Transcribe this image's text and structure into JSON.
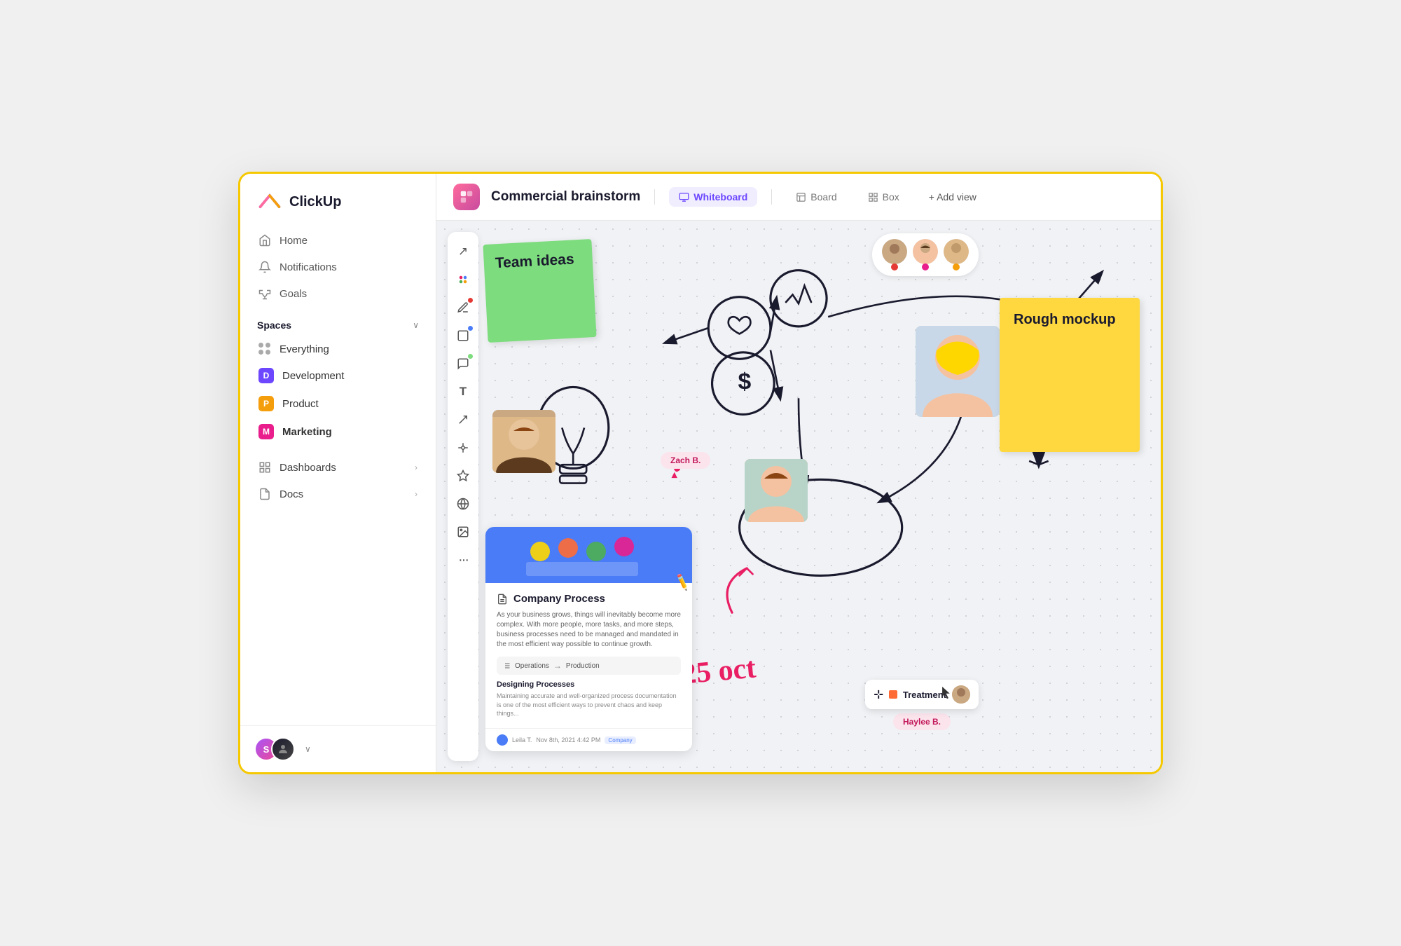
{
  "app": {
    "name": "ClickUp"
  },
  "sidebar": {
    "logo": "ClickUp",
    "nav": [
      {
        "id": "home",
        "label": "Home",
        "icon": "home"
      },
      {
        "id": "notifications",
        "label": "Notifications",
        "icon": "bell"
      },
      {
        "id": "goals",
        "label": "Goals",
        "icon": "trophy"
      }
    ],
    "spaces_label": "Spaces",
    "spaces": [
      {
        "id": "everything",
        "label": "Everything",
        "color": "",
        "initial": ""
      },
      {
        "id": "development",
        "label": "Development",
        "color": "#6c47ff",
        "initial": "D"
      },
      {
        "id": "product",
        "label": "Product",
        "color": "#f59e0b",
        "initial": "P"
      },
      {
        "id": "marketing",
        "label": "Marketing",
        "color": "#e91e8c",
        "initial": "M",
        "bold": true
      }
    ],
    "dashboards_label": "Dashboards",
    "docs_label": "Docs",
    "user_initial": "S"
  },
  "topbar": {
    "title": "Commercial brainstorm",
    "views": [
      {
        "id": "whiteboard",
        "label": "Whiteboard",
        "active": true
      },
      {
        "id": "board",
        "label": "Board",
        "active": false
      },
      {
        "id": "box",
        "label": "Box",
        "active": false
      }
    ],
    "add_view": "+ Add view"
  },
  "canvas": {
    "sticky_green_text": "Team ideas",
    "sticky_yellow_text": "Rough mockup",
    "doc_title": "Company Process",
    "doc_description": "As your business grows, things will inevitably become more complex. With more people, more tasks, and more steps, business processes need to be managed and mandated in the most efficient way possible to continue growth.",
    "doc_process_from": "Operations",
    "doc_process_to": "Production",
    "doc_section_title": "Designing Processes",
    "doc_section_text": "Maintaining accurate and well-organized process documentation is one of the most efficient ways to prevent chaos and keep things...",
    "doc_author": "Leila T.",
    "doc_date": "Nov 8th, 2021 4:42 PM",
    "doc_badge": "Company",
    "date_handwriting": "25 oct",
    "name_zach": "Zach B.",
    "name_haylee": "Haylee B.",
    "treatment_label": "Treatment",
    "tools": [
      {
        "id": "cursor",
        "symbol": "↗",
        "dot_color": ""
      },
      {
        "id": "palette",
        "symbol": "🎨",
        "dot_color": ""
      },
      {
        "id": "pencil",
        "symbol": "✏",
        "dot_color": "#e53935"
      },
      {
        "id": "rectangle",
        "symbol": "▢",
        "dot_color": "#4a7cf7"
      },
      {
        "id": "comment",
        "symbol": "💬",
        "dot_color": "#7ddc7d"
      },
      {
        "id": "text",
        "symbol": "T",
        "dot_color": ""
      },
      {
        "id": "connector",
        "symbol": "↗",
        "dot_color": ""
      },
      {
        "id": "hub",
        "symbol": "❋",
        "dot_color": ""
      },
      {
        "id": "star",
        "symbol": "✦",
        "dot_color": ""
      },
      {
        "id": "globe",
        "symbol": "◎",
        "dot_color": ""
      },
      {
        "id": "image",
        "symbol": "⊡",
        "dot_color": ""
      },
      {
        "id": "more",
        "symbol": "•••",
        "dot_color": ""
      }
    ]
  }
}
